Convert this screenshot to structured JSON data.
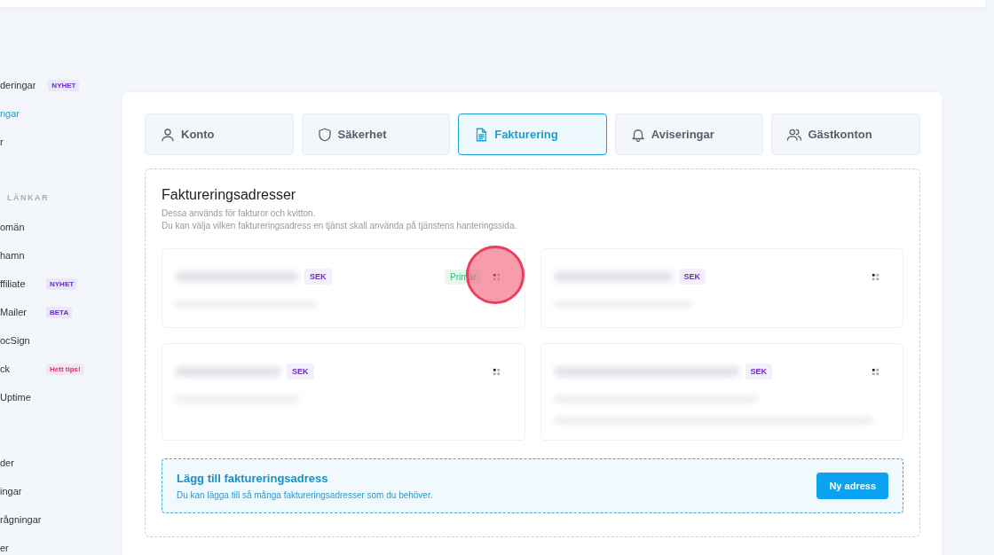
{
  "sidebar": {
    "groups": [
      {
        "items": [
          {
            "label": "deringar",
            "selected": false,
            "badge": {
              "text": "NYHET",
              "color": "#6a2fc2"
            }
          },
          {
            "label": "ngar",
            "selected": true
          },
          {
            "label": "r",
            "selected": false
          }
        ]
      },
      {
        "heading": "LÄNKAR",
        "items": [
          {
            "label": "omän",
            "selected": false
          },
          {
            "label": "hamn",
            "selected": false
          },
          {
            "label": "ffiliate",
            "selected": false,
            "badge": {
              "text": "NYHET",
              "color": "#6a2fc2"
            }
          },
          {
            "label": "Mailer",
            "selected": false,
            "badge": {
              "text": "BETA",
              "color": "#6a2fc2"
            }
          },
          {
            "label": "ocSign",
            "selected": false
          },
          {
            "label": "ck",
            "selected": false,
            "badge": {
              "text": "Hett tips!",
              "color": "#e0356a"
            }
          },
          {
            "label": "Uptime",
            "selected": false
          }
        ]
      },
      {
        "items": [
          {
            "label": "der",
            "selected": false
          },
          {
            "label": "ingar",
            "selected": false
          },
          {
            "label": "rågningar",
            "selected": false
          },
          {
            "label": "er",
            "selected": false
          }
        ]
      }
    ]
  },
  "tabs": [
    {
      "label": "Konto",
      "selected": false
    },
    {
      "label": "Säkerhet",
      "selected": false
    },
    {
      "label": "Fakturering",
      "selected": true
    },
    {
      "label": "Aviseringar",
      "selected": false
    },
    {
      "label": "Gästkonton",
      "selected": false
    }
  ],
  "section": {
    "title": "Faktureringsadresser",
    "description": [
      "Dessa används för fakturor och kvitton.",
      "Du kan välja vilken faktureringsadress en tjänst skall använda på tjänstens hanteringssida."
    ]
  },
  "addresses": [
    {
      "currency": "SEK",
      "primary_label": "Primär",
      "highlighted": true
    },
    {
      "currency": "SEK",
      "highlighted": false
    },
    {
      "currency": "SEK",
      "highlighted": false
    },
    {
      "currency": "SEK",
      "highlighted": false
    }
  ],
  "add_panel": {
    "title": "Lägg till faktureringsadress",
    "text": "Du kan lägga till så många faktureringsadresser som du behöver.",
    "button": "Ny adress"
  }
}
